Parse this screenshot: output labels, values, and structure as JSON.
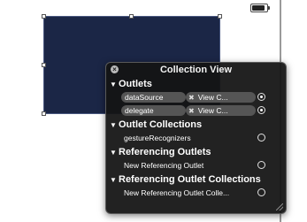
{
  "hud": {
    "title": "Collection View",
    "close_glyph": "×",
    "sections": [
      {
        "label": "Outlets",
        "rows": [
          {
            "name": "dataSource",
            "target": "View C...",
            "connected": true
          },
          {
            "name": "delegate",
            "target": "View C...",
            "connected": true
          }
        ]
      },
      {
        "label": "Outlet Collections",
        "rows": [
          {
            "name": "gestureRecognizers",
            "connected": false
          }
        ]
      },
      {
        "label": "Referencing Outlets",
        "rows": [
          {
            "name": "New Referencing Outlet",
            "connected": false
          }
        ]
      },
      {
        "label": "Referencing Outlet Collections",
        "rows": [
          {
            "name": "New Referencing Outlet Colle...",
            "connected": false
          }
        ]
      }
    ]
  },
  "glyphs": {
    "disclosure": "▼",
    "remove": "✖"
  },
  "colors": {
    "view_fill": "#1b2646",
    "hud_bg": "#141414"
  }
}
